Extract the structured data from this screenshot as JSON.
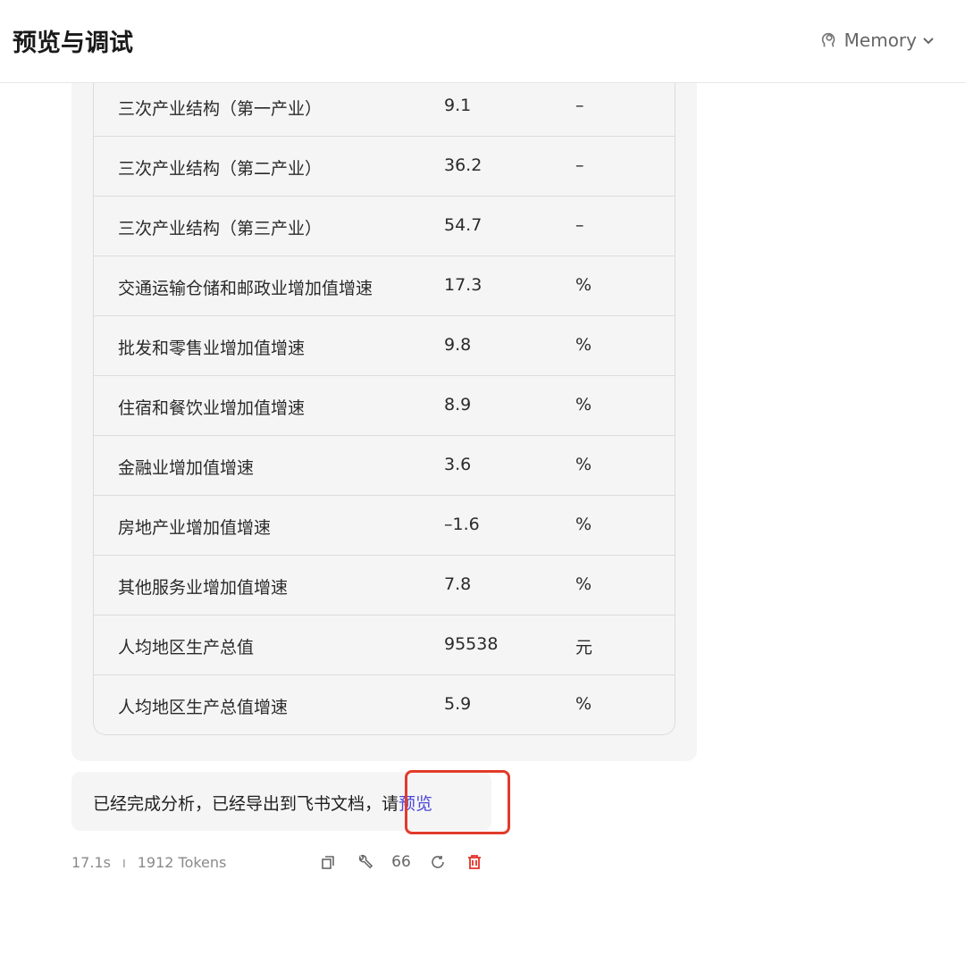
{
  "header": {
    "title": "预览与调试",
    "memory_label": "Memory"
  },
  "table": {
    "rows": [
      [
        "三次产业结构（第一产业）",
        "9.1",
        "–"
      ],
      [
        "三次产业结构（第二产业）",
        "36.2",
        "–"
      ],
      [
        "三次产业结构（第三产业）",
        "54.7",
        "–"
      ],
      [
        "交通运输仓储和邮政业增加值增速",
        "17.3",
        "%"
      ],
      [
        "批发和零售业增加值增速",
        "9.8",
        "%"
      ],
      [
        "住宿和餐饮业增加值增速",
        "8.9",
        "%"
      ],
      [
        "金融业增加值增速",
        "3.6",
        "%"
      ],
      [
        "房地产业增加值增速",
        "–1.6",
        "%"
      ],
      [
        "其他服务业增加值增速",
        "7.8",
        "%"
      ],
      [
        "人均地区生产总值",
        "95538",
        "元"
      ],
      [
        "人均地区生产总值增速",
        "5.9",
        "%"
      ]
    ]
  },
  "message": {
    "text": "已经完成分析，已经导出到飞书文档，请",
    "link": "预览"
  },
  "meta": {
    "time": "17.1s",
    "separator": "I",
    "tokens": "1912 Tokens"
  },
  "actions": [
    "copy-icon",
    "wrench-icon",
    "quote-icon",
    "refresh-icon",
    "delete-icon"
  ],
  "colors": {
    "link": "#4e49d8",
    "highlight": "#e23b2a",
    "delete": "#e5312a"
  }
}
